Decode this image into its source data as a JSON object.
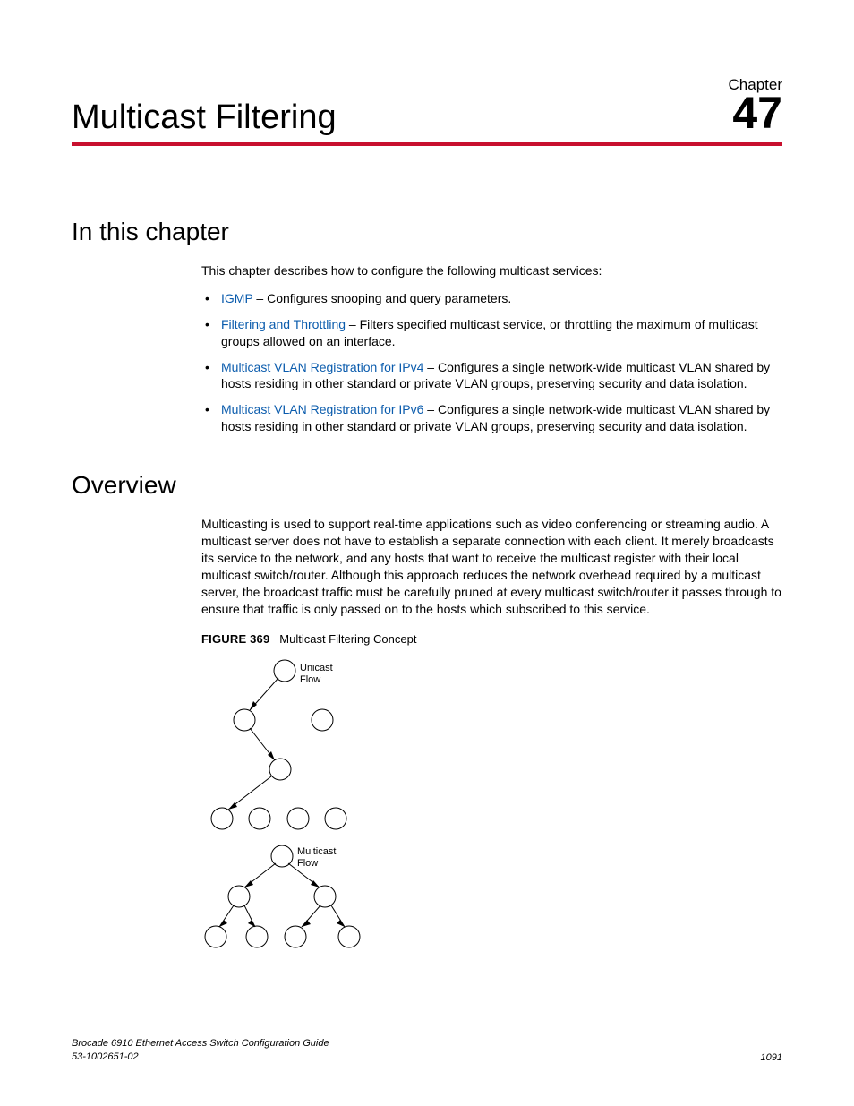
{
  "header": {
    "chapter_label": "Chapter",
    "chapter_num": "47",
    "title": "Multicast Filtering"
  },
  "section1": {
    "heading": "In this chapter",
    "intro": "This chapter describes how to configure the following multicast services:",
    "items": [
      {
        "link": "IGMP",
        "rest": " – Configures snooping and query parameters."
      },
      {
        "link": "Filtering and Throttling",
        "rest": " – Filters specified multicast service, or throttling the maximum of multicast groups allowed on an interface."
      },
      {
        "link": "Multicast VLAN Registration for IPv4",
        "rest": " – Configures a single network-wide multicast VLAN shared by hosts residing in other standard or private VLAN groups, preserving security and data isolation."
      },
      {
        "link": "Multicast VLAN Registration for IPv6",
        "rest": " – Configures a single network-wide multicast VLAN shared by hosts residing in other standard or private VLAN groups, preserving security and data isolation."
      }
    ]
  },
  "section2": {
    "heading": "Overview",
    "para": "Multicasting is used to support real-time applications such as video conferencing or streaming audio. A multicast server does not have to establish a separate connection with each client. It merely broadcasts its service to the network, and any hosts that want to receive the multicast register with their local multicast switch/router. Although this approach reduces the network overhead required by a multicast server, the broadcast traffic must be carefully pruned at every multicast switch/router it passes through to ensure that traffic is only passed on to the hosts which subscribed to this service.",
    "figure": {
      "label": "FIGURE 369",
      "caption": "Multicast Filtering Concept",
      "unicast_label_1": "Unicast",
      "unicast_label_2": "Flow",
      "multicast_label_1": "Multicast",
      "multicast_label_2": "Flow"
    }
  },
  "footer": {
    "book": "Brocade 6910 Ethernet Access Switch Configuration Guide",
    "docnum": "53-1002651-02",
    "page": "1091"
  }
}
